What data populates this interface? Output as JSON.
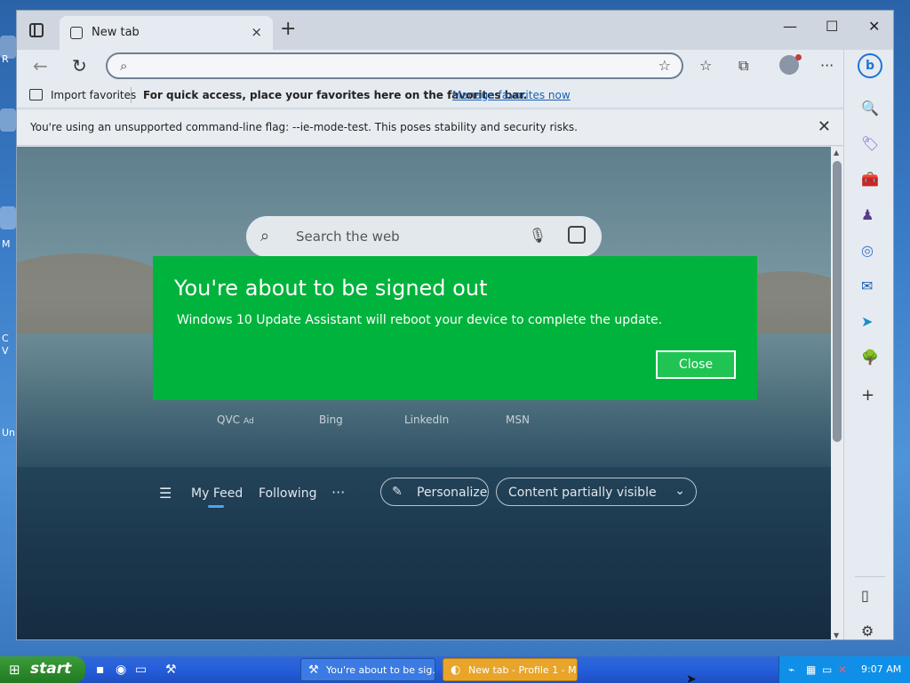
{
  "desktop": {
    "icon_labels": [
      "R",
      "M",
      "C",
      "V",
      "Un"
    ]
  },
  "browser": {
    "tab": {
      "title": "New tab",
      "close_glyph": "×"
    },
    "new_tab_glyph": "+",
    "window_controls": {
      "minimize": "—",
      "maximize": "☐",
      "close": "✕"
    },
    "toolbar": {
      "back_glyph": "←",
      "refresh_glyph": "↻",
      "address_placeholder": "",
      "search_icon": "⌕",
      "favorite_star": "☆",
      "favorites_glyph": "☆",
      "collections_glyph": "⧉",
      "more_glyph": "···"
    },
    "favorites_bar": {
      "import_label": "Import favorites",
      "message": "For quick access, place your favorites here on the favorites bar.",
      "manage_link": "Manage favorites now"
    },
    "infobar": {
      "message": "You're using an unsupported command-line flag: --ie-mode-test. This poses stability and security risks.",
      "close_glyph": "✕"
    },
    "newtab": {
      "search_placeholder": "Search the web",
      "quick_links": [
        {
          "label": "QVC",
          "ad": "Ad"
        },
        {
          "label": "Bing"
        },
        {
          "label": "LinkedIn"
        },
        {
          "label": "MSN"
        }
      ],
      "feed": {
        "my_feed": "My Feed",
        "following": "Following",
        "more": "···",
        "personalize": "Personalize",
        "content_visibility": "Content partially visible"
      }
    },
    "sidebar": {
      "bing_label": "b",
      "add_glyph": "+"
    }
  },
  "modal": {
    "title": "You're about to be signed out",
    "message": "Windows 10 Update Assistant will reboot your device to complete the update.",
    "close_label": "Close"
  },
  "taskbar": {
    "start_label": "start",
    "tasks": [
      {
        "label": "You're about to be sig..."
      },
      {
        "label": "New tab - Profile 1 - Mi..."
      }
    ],
    "clock": "9:07 AM"
  },
  "colors": {
    "modal_bg": "#00b33c",
    "link": "#1a5fb4",
    "taskbar": "#245edb",
    "start": "#2c8a2c"
  }
}
